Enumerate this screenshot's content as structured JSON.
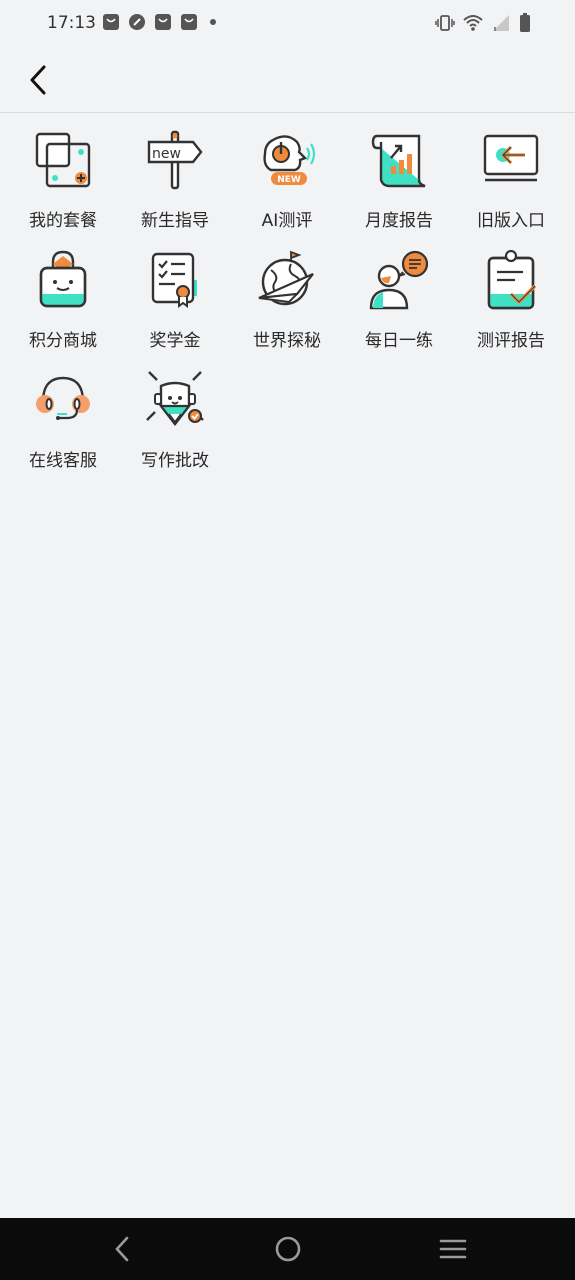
{
  "status_bar": {
    "time": "17:13",
    "notification_icons": [
      "shopping-bag-icon",
      "compass-icon",
      "shopping-bag-icon",
      "shopping-bag-icon",
      "dot-icon"
    ],
    "system_icons": [
      "vibrate-icon",
      "wifi-icon",
      "signal-icon",
      "battery-icon"
    ]
  },
  "app_bar": {
    "back_icon": "chevron-left-icon"
  },
  "menu": {
    "items": [
      {
        "label": "我的套餐",
        "icon": "package-icon"
      },
      {
        "label": "新生指导",
        "icon": "signpost-new-icon"
      },
      {
        "label": "AI测评",
        "icon": "ai-assessment-icon",
        "badge": "NEW"
      },
      {
        "label": "月度报告",
        "icon": "monthly-report-icon"
      },
      {
        "label": "旧版入口",
        "icon": "old-version-entry-icon"
      },
      {
        "label": "积分商城",
        "icon": "points-mall-icon"
      },
      {
        "label": "奖学金",
        "icon": "scholarship-icon"
      },
      {
        "label": "世界探秘",
        "icon": "world-explore-icon"
      },
      {
        "label": "每日一练",
        "icon": "daily-practice-icon"
      },
      {
        "label": "测评报告",
        "icon": "assessment-report-icon"
      },
      {
        "label": "在线客服",
        "icon": "customer-service-icon"
      },
      {
        "label": "写作批改",
        "icon": "writing-correction-icon"
      }
    ]
  },
  "colors": {
    "accent_orange": "#f08a3c",
    "accent_teal": "#3fe0c4",
    "outline": "#333333",
    "background": "#f2f3f5",
    "nav_bar": "#0b0b0b"
  },
  "nav_bar": {
    "icons": [
      "back-triangle-icon",
      "home-circle-icon",
      "menu-lines-icon"
    ]
  }
}
